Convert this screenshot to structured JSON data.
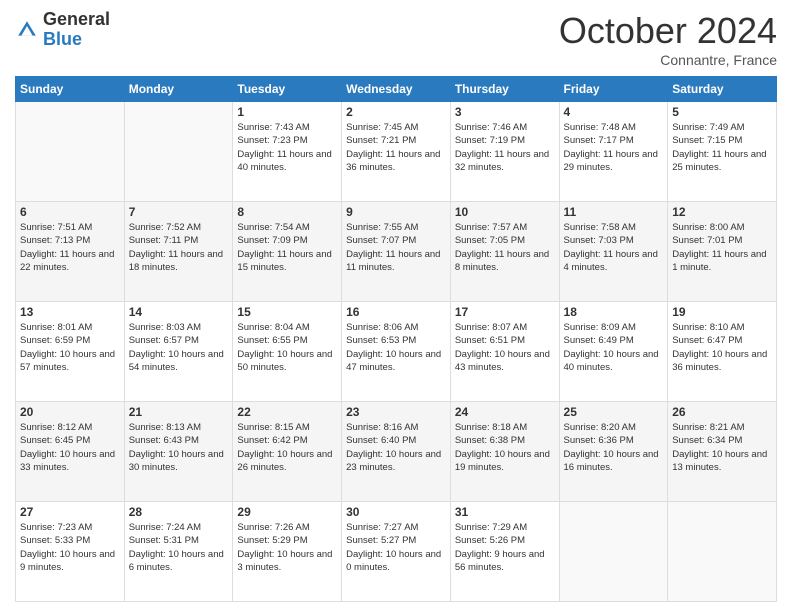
{
  "logo": {
    "general": "General",
    "blue": "Blue"
  },
  "header": {
    "month": "October 2024",
    "location": "Connantre, France"
  },
  "days_of_week": [
    "Sunday",
    "Monday",
    "Tuesday",
    "Wednesday",
    "Thursday",
    "Friday",
    "Saturday"
  ],
  "weeks": [
    [
      {
        "day": "",
        "sunrise": "",
        "sunset": "",
        "daylight": "",
        "empty": true
      },
      {
        "day": "",
        "sunrise": "",
        "sunset": "",
        "daylight": "",
        "empty": true
      },
      {
        "day": "1",
        "sunrise": "Sunrise: 7:43 AM",
        "sunset": "Sunset: 7:23 PM",
        "daylight": "Daylight: 11 hours and 40 minutes."
      },
      {
        "day": "2",
        "sunrise": "Sunrise: 7:45 AM",
        "sunset": "Sunset: 7:21 PM",
        "daylight": "Daylight: 11 hours and 36 minutes."
      },
      {
        "day": "3",
        "sunrise": "Sunrise: 7:46 AM",
        "sunset": "Sunset: 7:19 PM",
        "daylight": "Daylight: 11 hours and 32 minutes."
      },
      {
        "day": "4",
        "sunrise": "Sunrise: 7:48 AM",
        "sunset": "Sunset: 7:17 PM",
        "daylight": "Daylight: 11 hours and 29 minutes."
      },
      {
        "day": "5",
        "sunrise": "Sunrise: 7:49 AM",
        "sunset": "Sunset: 7:15 PM",
        "daylight": "Daylight: 11 hours and 25 minutes."
      }
    ],
    [
      {
        "day": "6",
        "sunrise": "Sunrise: 7:51 AM",
        "sunset": "Sunset: 7:13 PM",
        "daylight": "Daylight: 11 hours and 22 minutes."
      },
      {
        "day": "7",
        "sunrise": "Sunrise: 7:52 AM",
        "sunset": "Sunset: 7:11 PM",
        "daylight": "Daylight: 11 hours and 18 minutes."
      },
      {
        "day": "8",
        "sunrise": "Sunrise: 7:54 AM",
        "sunset": "Sunset: 7:09 PM",
        "daylight": "Daylight: 11 hours and 15 minutes."
      },
      {
        "day": "9",
        "sunrise": "Sunrise: 7:55 AM",
        "sunset": "Sunset: 7:07 PM",
        "daylight": "Daylight: 11 hours and 11 minutes."
      },
      {
        "day": "10",
        "sunrise": "Sunrise: 7:57 AM",
        "sunset": "Sunset: 7:05 PM",
        "daylight": "Daylight: 11 hours and 8 minutes."
      },
      {
        "day": "11",
        "sunrise": "Sunrise: 7:58 AM",
        "sunset": "Sunset: 7:03 PM",
        "daylight": "Daylight: 11 hours and 4 minutes."
      },
      {
        "day": "12",
        "sunrise": "Sunrise: 8:00 AM",
        "sunset": "Sunset: 7:01 PM",
        "daylight": "Daylight: 11 hours and 1 minute."
      }
    ],
    [
      {
        "day": "13",
        "sunrise": "Sunrise: 8:01 AM",
        "sunset": "Sunset: 6:59 PM",
        "daylight": "Daylight: 10 hours and 57 minutes."
      },
      {
        "day": "14",
        "sunrise": "Sunrise: 8:03 AM",
        "sunset": "Sunset: 6:57 PM",
        "daylight": "Daylight: 10 hours and 54 minutes."
      },
      {
        "day": "15",
        "sunrise": "Sunrise: 8:04 AM",
        "sunset": "Sunset: 6:55 PM",
        "daylight": "Daylight: 10 hours and 50 minutes."
      },
      {
        "day": "16",
        "sunrise": "Sunrise: 8:06 AM",
        "sunset": "Sunset: 6:53 PM",
        "daylight": "Daylight: 10 hours and 47 minutes."
      },
      {
        "day": "17",
        "sunrise": "Sunrise: 8:07 AM",
        "sunset": "Sunset: 6:51 PM",
        "daylight": "Daylight: 10 hours and 43 minutes."
      },
      {
        "day": "18",
        "sunrise": "Sunrise: 8:09 AM",
        "sunset": "Sunset: 6:49 PM",
        "daylight": "Daylight: 10 hours and 40 minutes."
      },
      {
        "day": "19",
        "sunrise": "Sunrise: 8:10 AM",
        "sunset": "Sunset: 6:47 PM",
        "daylight": "Daylight: 10 hours and 36 minutes."
      }
    ],
    [
      {
        "day": "20",
        "sunrise": "Sunrise: 8:12 AM",
        "sunset": "Sunset: 6:45 PM",
        "daylight": "Daylight: 10 hours and 33 minutes."
      },
      {
        "day": "21",
        "sunrise": "Sunrise: 8:13 AM",
        "sunset": "Sunset: 6:43 PM",
        "daylight": "Daylight: 10 hours and 30 minutes."
      },
      {
        "day": "22",
        "sunrise": "Sunrise: 8:15 AM",
        "sunset": "Sunset: 6:42 PM",
        "daylight": "Daylight: 10 hours and 26 minutes."
      },
      {
        "day": "23",
        "sunrise": "Sunrise: 8:16 AM",
        "sunset": "Sunset: 6:40 PM",
        "daylight": "Daylight: 10 hours and 23 minutes."
      },
      {
        "day": "24",
        "sunrise": "Sunrise: 8:18 AM",
        "sunset": "Sunset: 6:38 PM",
        "daylight": "Daylight: 10 hours and 19 minutes."
      },
      {
        "day": "25",
        "sunrise": "Sunrise: 8:20 AM",
        "sunset": "Sunset: 6:36 PM",
        "daylight": "Daylight: 10 hours and 16 minutes."
      },
      {
        "day": "26",
        "sunrise": "Sunrise: 8:21 AM",
        "sunset": "Sunset: 6:34 PM",
        "daylight": "Daylight: 10 hours and 13 minutes."
      }
    ],
    [
      {
        "day": "27",
        "sunrise": "Sunrise: 7:23 AM",
        "sunset": "Sunset: 5:33 PM",
        "daylight": "Daylight: 10 hours and 9 minutes."
      },
      {
        "day": "28",
        "sunrise": "Sunrise: 7:24 AM",
        "sunset": "Sunset: 5:31 PM",
        "daylight": "Daylight: 10 hours and 6 minutes."
      },
      {
        "day": "29",
        "sunrise": "Sunrise: 7:26 AM",
        "sunset": "Sunset: 5:29 PM",
        "daylight": "Daylight: 10 hours and 3 minutes."
      },
      {
        "day": "30",
        "sunrise": "Sunrise: 7:27 AM",
        "sunset": "Sunset: 5:27 PM",
        "daylight": "Daylight: 10 hours and 0 minutes."
      },
      {
        "day": "31",
        "sunrise": "Sunrise: 7:29 AM",
        "sunset": "Sunset: 5:26 PM",
        "daylight": "Daylight: 9 hours and 56 minutes."
      },
      {
        "day": "",
        "sunrise": "",
        "sunset": "",
        "daylight": "",
        "empty": true
      },
      {
        "day": "",
        "sunrise": "",
        "sunset": "",
        "daylight": "",
        "empty": true
      }
    ]
  ]
}
